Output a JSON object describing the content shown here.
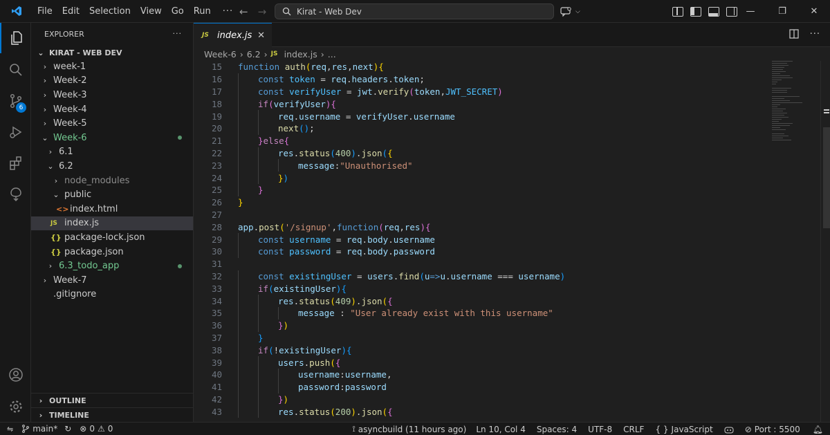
{
  "window": {
    "title": "Kirat - Web Dev",
    "menu": [
      "File",
      "Edit",
      "Selection",
      "View",
      "Go",
      "Run"
    ],
    "more": "···"
  },
  "colors": {
    "accent": "#0078d4",
    "background": "#1f1f1f",
    "sidebar": "#181818",
    "git_added": "#73c991"
  },
  "activitybar": {
    "items": [
      "files-icon",
      "search-icon",
      "source-control-icon",
      "run-debug-icon",
      "extensions-icon",
      "remote-explorer-icon"
    ],
    "source_control_badge": "6",
    "bottom": [
      "account-icon",
      "manage-gear-icon"
    ]
  },
  "sidebar": {
    "title": "EXPLORER",
    "more": "···",
    "root": "KIRAT - WEB DEV",
    "tree": [
      {
        "label": "week-1",
        "depth": 0,
        "kind": "folder",
        "open": false
      },
      {
        "label": "Week-2",
        "depth": 0,
        "kind": "folder",
        "open": false
      },
      {
        "label": "Week-3",
        "depth": 0,
        "kind": "folder",
        "open": false
      },
      {
        "label": "Week-4",
        "depth": 0,
        "kind": "folder",
        "open": false
      },
      {
        "label": "Week-5",
        "depth": 0,
        "kind": "folder",
        "open": false
      },
      {
        "label": "Week-6",
        "depth": 0,
        "kind": "folder",
        "open": true,
        "modified": true
      },
      {
        "label": "6.1",
        "depth": 1,
        "kind": "folder",
        "open": false
      },
      {
        "label": "6.2",
        "depth": 1,
        "kind": "folder",
        "open": true
      },
      {
        "label": "node_modules",
        "depth": 2,
        "kind": "folder",
        "open": false,
        "dim": true
      },
      {
        "label": "public",
        "depth": 2,
        "kind": "folder",
        "open": true
      },
      {
        "label": "index.html",
        "depth": 3,
        "kind": "html"
      },
      {
        "label": "index.js",
        "depth": 2,
        "kind": "js",
        "selected": true
      },
      {
        "label": "package-lock.json",
        "depth": 2,
        "kind": "json"
      },
      {
        "label": "package.json",
        "depth": 2,
        "kind": "json"
      },
      {
        "label": "6.3_todo_app",
        "depth": 1,
        "kind": "folder",
        "open": false,
        "modified": true
      },
      {
        "label": "Week-7",
        "depth": 0,
        "kind": "folder",
        "open": false
      },
      {
        "label": ".gitignore",
        "depth": 0,
        "kind": "file"
      }
    ],
    "outline": "OUTLINE",
    "timeline": "TIMELINE"
  },
  "editor": {
    "tab": {
      "label": "index.js",
      "icon": "JS",
      "close": "✕"
    },
    "breadcrumb": [
      "Week-6",
      "6.2",
      "index.js",
      "..."
    ],
    "lines": [
      {
        "n": "15",
        "indent": 0,
        "html": "<span class='kw'>function</span> <span class='fn'>auth</span><span class='b1'>(</span><span class='var'>req</span>,<span class='var'>res</span>,<span class='var'>next</span><span class='b1'>)</span><span class='b1'>{</span>"
      },
      {
        "n": "16",
        "indent": 1,
        "html": "<span class='kw'>const</span> <span class='const'>token</span> = <span class='var'>req</span>.<span class='var'>headers</span>.<span class='var'>token</span>;"
      },
      {
        "n": "17",
        "indent": 1,
        "html": "<span class='kw'>const</span> <span class='const'>verifyUser</span> = <span class='var'>jwt</span>.<span class='fn'>verify</span><span class='b2'>(</span><span class='var'>token</span>,<span class='const'>JWT_SECRET</span><span class='b2'>)</span>"
      },
      {
        "n": "18",
        "indent": 1,
        "html": "<span class='ctrl'>if</span><span class='b2'>(</span><span class='var'>verifyUser</span><span class='b2'>)</span><span class='b2'>{</span>"
      },
      {
        "n": "19",
        "indent": 2,
        "html": "<span class='var'>req</span>.<span class='var'>username</span> = <span class='var'>verifyUser</span>.<span class='var'>username</span>"
      },
      {
        "n": "20",
        "indent": 2,
        "html": "<span class='fn'>next</span><span class='b3'>()</span>;"
      },
      {
        "n": "21",
        "indent": 1,
        "html": "<span class='b2'>}</span><span class='ctrl'>else</span><span class='b2'>{</span>"
      },
      {
        "n": "22",
        "indent": 2,
        "html": "<span class='var'>res</span>.<span class='fn'>status</span><span class='b3'>(</span><span class='num'>400</span><span class='b3'>)</span>.<span class='fn'>json</span><span class='b3'>(</span><span class='b1'>{</span>"
      },
      {
        "n": "23",
        "indent": 3,
        "html": "<span class='var'>message</span>:<span class='str'>\"Unauthorised\"</span>"
      },
      {
        "n": "24",
        "indent": 2,
        "html": "<span class='b1'>}</span><span class='b3'>)</span>"
      },
      {
        "n": "25",
        "indent": 1,
        "html": "<span class='b2'>}</span>"
      },
      {
        "n": "26",
        "indent": 0,
        "html": "<span class='b1'>}</span>"
      },
      {
        "n": "27",
        "indent": 0,
        "html": ""
      },
      {
        "n": "28",
        "indent": 0,
        "html": "<span class='var'>app</span>.<span class='fn'>post</span><span class='b1'>(</span><span class='str'>'/signup'</span>,<span class='kw'>function</span><span class='b2'>(</span><span class='var'>req</span>,<span class='var'>res</span><span class='b2'>)</span><span class='b2'>{</span>"
      },
      {
        "n": "29",
        "indent": 1,
        "html": "<span class='kw'>const</span> <span class='const'>username</span> = <span class='var'>req</span>.<span class='var'>body</span>.<span class='var'>username</span>"
      },
      {
        "n": "30",
        "indent": 1,
        "html": "<span class='kw'>const</span> <span class='const'>password</span> = <span class='var'>req</span>.<span class='var'>body</span>.<span class='var'>password</span>"
      },
      {
        "n": "31",
        "indent": 0,
        "html": ""
      },
      {
        "n": "32",
        "indent": 1,
        "html": "<span class='kw'>const</span> <span class='const'>existingUser</span> = <span class='var'>users</span>.<span class='fn'>find</span><span class='b3'>(</span><span class='var'>u</span><span class='kw'>=&gt;</span><span class='var'>u</span>.<span class='var'>username</span> === <span class='var'>username</span><span class='b3'>)</span>"
      },
      {
        "n": "33",
        "indent": 1,
        "html": "<span class='ctrl'>if</span><span class='b3'>(</span><span class='var'>existingUser</span><span class='b3'>)</span><span class='b3'>{</span>"
      },
      {
        "n": "34",
        "indent": 2,
        "html": "<span class='var'>res</span>.<span class='fn'>status</span><span class='b1'>(</span><span class='num'>409</span><span class='b1'>)</span>.<span class='fn'>json</span><span class='b1'>(</span><span class='b2'>{</span>"
      },
      {
        "n": "35",
        "indent": 3,
        "html": "<span class='var'>message</span> : <span class='str'>\"User already exist with this username\"</span>"
      },
      {
        "n": "36",
        "indent": 2,
        "html": "<span class='b2'>}</span><span class='b1'>)</span>"
      },
      {
        "n": "37",
        "indent": 1,
        "html": "<span class='b3'>}</span>"
      },
      {
        "n": "38",
        "indent": 1,
        "html": "<span class='ctrl'>if</span><span class='b3'>(</span>!<span class='var'>existingUser</span><span class='b3'>)</span><span class='b3'>{</span>"
      },
      {
        "n": "39",
        "indent": 2,
        "html": "<span class='var'>users</span>.<span class='fn'>push</span><span class='b1'>(</span><span class='b2'>{</span>"
      },
      {
        "n": "40",
        "indent": 3,
        "html": "<span class='var'>username</span>:<span class='var'>username</span>,"
      },
      {
        "n": "41",
        "indent": 3,
        "html": "<span class='var'>password</span>:<span class='var'>password</span>"
      },
      {
        "n": "42",
        "indent": 2,
        "html": "<span class='b2'>}</span><span class='b1'>)</span>"
      },
      {
        "n": "43",
        "indent": 2,
        "html": "<span class='var'>res</span>.<span class='fn'>status</span><span class='b1'>(</span><span class='num'>200</span><span class='b1'>)</span>.<span class='fn'>json</span><span class='b1'>(</span><span class='b2'>{</span>"
      }
    ]
  },
  "statusbar": {
    "branch": "main*",
    "errors": "0",
    "warnings": "0",
    "sync": "asyncbuild (11 hours ago)",
    "cursor": "Ln 10, Col 4",
    "spaces": "Spaces: 4",
    "encoding": "UTF-8",
    "eol": "CRLF",
    "language_braces": "{ }",
    "language": "JavaScript",
    "port": "Port : 5500"
  }
}
